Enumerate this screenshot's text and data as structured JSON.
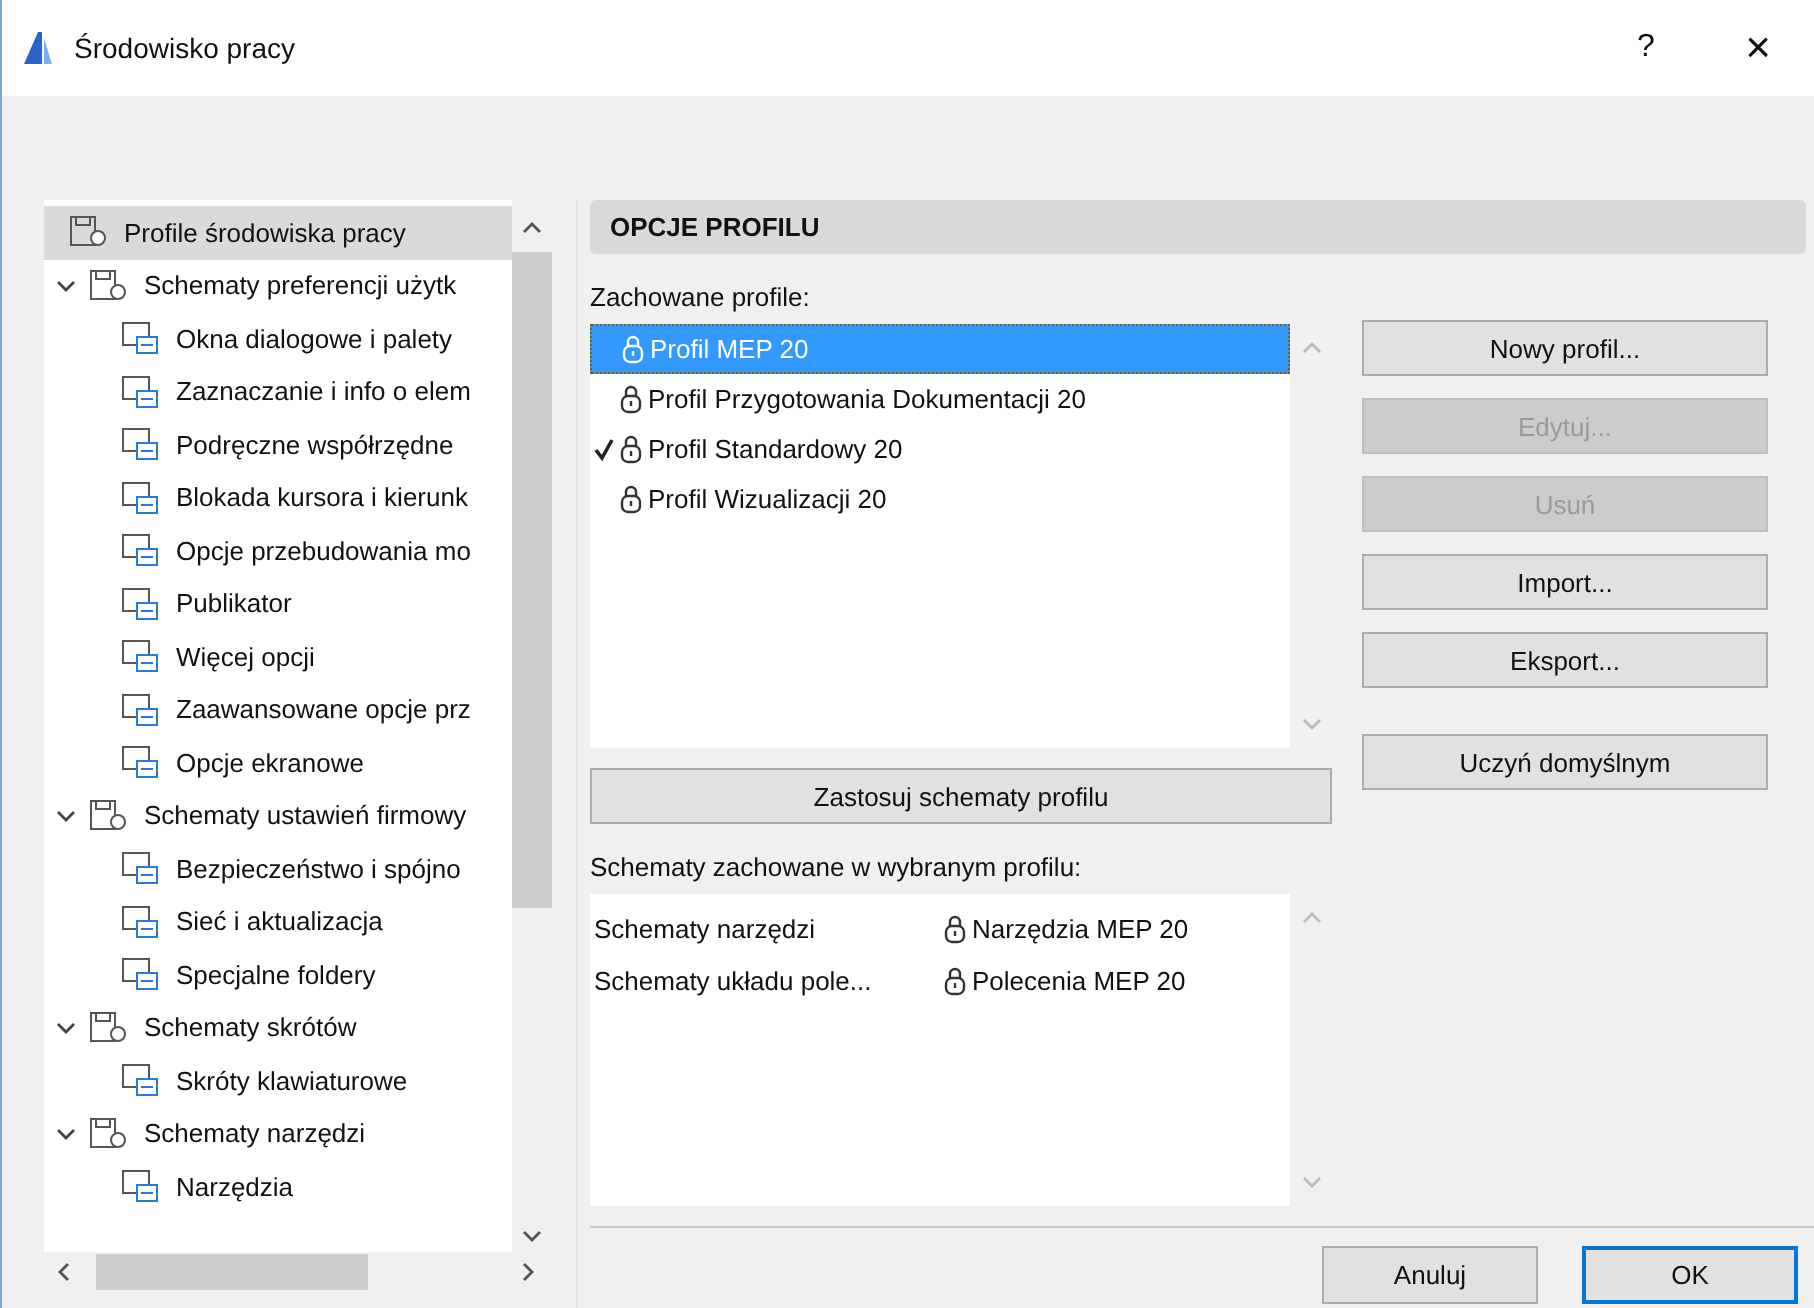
{
  "window": {
    "title": "Środowisko pracy",
    "help": "?",
    "close": "×"
  },
  "tree": [
    {
      "label": "Profile środowiska pracy",
      "selected": true
    },
    {
      "label": "Schematy preferencji użytk",
      "selected": false,
      "expanded": true,
      "children": [
        {
          "label": "Okna dialogowe i palety",
          "selected": false
        },
        {
          "label": "Zaznaczanie i info o elem",
          "selected": false
        },
        {
          "label": "Podręczne współrzędne",
          "selected": false
        },
        {
          "label": "Blokada kursora i kierunk",
          "selected": false
        },
        {
          "label": "Opcje przebudowania mo",
          "selected": false
        },
        {
          "label": "Publikator",
          "selected": false
        },
        {
          "label": "Więcej opcji",
          "selected": false
        },
        {
          "label": "Zaawansowane opcje prz",
          "selected": false
        },
        {
          "label": "Opcje ekranowe",
          "selected": false
        }
      ]
    },
    {
      "label": "Schematy ustawień firmowy",
      "selected": false,
      "expanded": true,
      "children": [
        {
          "label": "Bezpieczeństwo i spójno",
          "selected": false
        },
        {
          "label": "Sieć i aktualizacja",
          "selected": false
        },
        {
          "label": "Specjalne foldery",
          "selected": false
        }
      ]
    },
    {
      "label": "Schematy skrótów",
      "selected": false,
      "expanded": true,
      "children": [
        {
          "label": "Skróty klawiaturowe",
          "selected": false
        }
      ]
    },
    {
      "label": "Schematy narzędzi",
      "selected": false,
      "expanded": true,
      "children": [
        {
          "label": "Narzędzia",
          "selected": false
        }
      ]
    }
  ],
  "section_title": "OPCJE PROFILU",
  "profiles_label": "Zachowane profile:",
  "profiles": [
    {
      "label": "Profil MEP 20",
      "selected": true,
      "current": false
    },
    {
      "label": "Profil Przygotowania Dokumentacji 20",
      "selected": false,
      "current": false
    },
    {
      "label": "Profil Standardowy 20",
      "selected": false,
      "current": true
    },
    {
      "label": "Profil Wizualizacji 20",
      "selected": false,
      "current": false
    }
  ],
  "side_buttons": [
    {
      "label": "Nowy profil...",
      "disabled": false
    },
    {
      "label": "Edytuj...",
      "disabled": true
    },
    {
      "label": "Usuń",
      "disabled": true
    },
    {
      "label": "Import...",
      "disabled": false
    },
    {
      "label": "Eksport...",
      "disabled": false
    },
    {
      "label": "Uczyń domyślnym",
      "disabled": false
    }
  ],
  "apply_button": "Zastosuj schematy profilu",
  "schemes_label": "Schematy zachowane w wybranym profilu:",
  "schemes": [
    {
      "name": "Schematy narzędzi",
      "value": "Narzędzia MEP 20"
    },
    {
      "name": "Schematy układu pole...",
      "value": "Polecenia MEP 20"
    }
  ],
  "footer_buttons": [
    {
      "label": "Anuluj",
      "default": false
    },
    {
      "label": "OK",
      "default": true
    }
  ]
}
